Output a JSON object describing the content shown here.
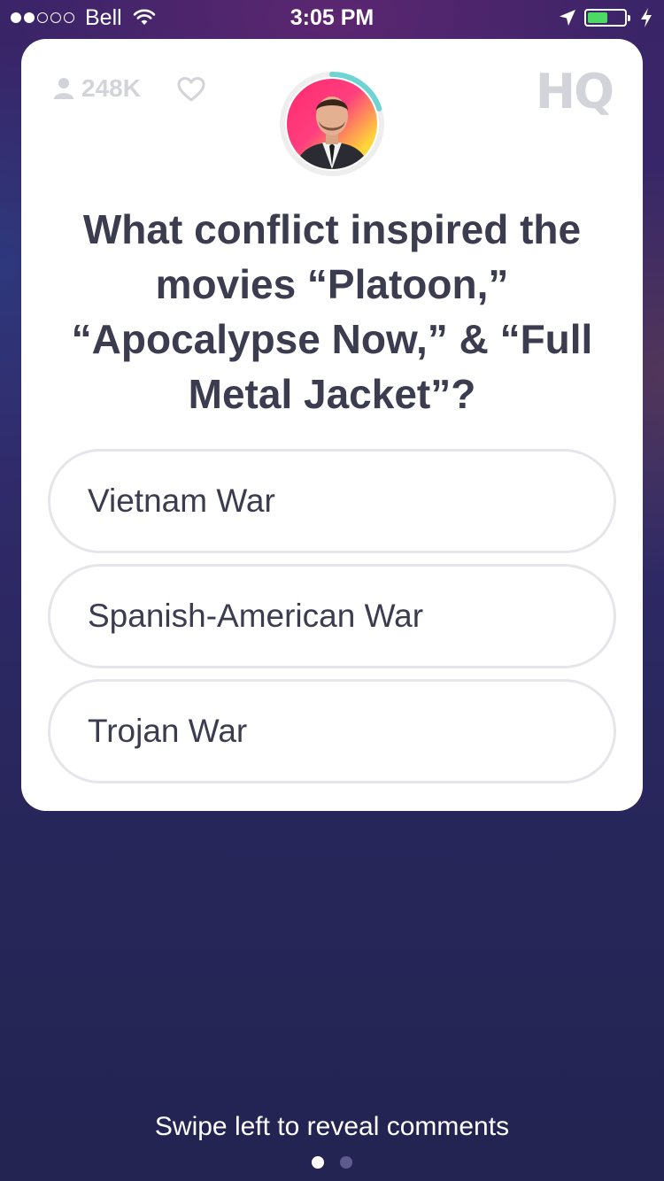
{
  "status_bar": {
    "carrier": "Bell",
    "time": "3:05 PM",
    "signal_strength": 2,
    "battery_level": 0.55,
    "battery_color": "#4cd964"
  },
  "game": {
    "viewer_count": "248K",
    "logo": "HQ",
    "timer_progress": 0.2,
    "timer_color": "#6dd3d3",
    "question": "What conflict inspired the movies “Platoon,” “Apocalypse Now,” & “Full Metal Jacket”?",
    "answers": [
      {
        "label": "Vietnam War"
      },
      {
        "label": "Spanish-American War"
      },
      {
        "label": "Trojan War"
      }
    ]
  },
  "footer": {
    "swipe_hint": "Swipe left to reveal comments",
    "page_count": 2,
    "active_page": 0
  },
  "colors": {
    "accent_text": "#3c3c50",
    "muted": "#d3d4da",
    "answer_border": "#e5e5ea"
  },
  "icons": [
    "person-icon",
    "heart-icon",
    "wifi-icon",
    "location-arrow-icon",
    "battery-icon",
    "charging-bolt-icon"
  ]
}
